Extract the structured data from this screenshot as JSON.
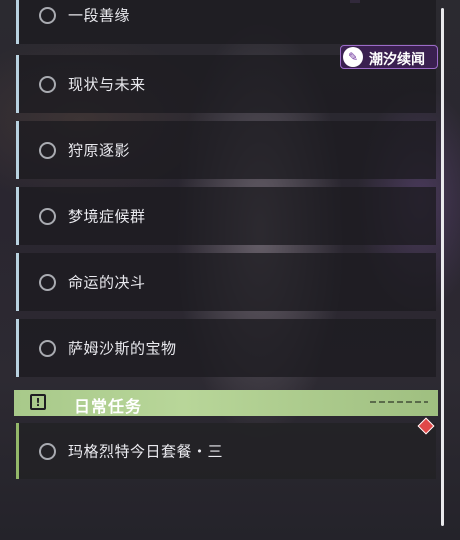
{
  "quests": [
    {
      "label": "一段善缘"
    },
    {
      "label": "现状与未来"
    },
    {
      "label": "狩原逐影"
    },
    {
      "label": "梦境症候群"
    },
    {
      "label": "命运的决斗"
    },
    {
      "label": "萨姆沙斯的宝物"
    }
  ],
  "daily_section": {
    "title": "日常任务",
    "icon": "exclamation-icon",
    "quest": {
      "label": "玛格烈特今日套餐・三"
    }
  },
  "badge": {
    "text": "潮汐续闻",
    "icon": "pen-logo-icon"
  },
  "colors": {
    "accent_blue": "#b9d2e0",
    "accent_green": "#94b86a",
    "header_green": "#b8d699",
    "badge_purple": "#3a2050",
    "marker_red": "#e04848"
  }
}
